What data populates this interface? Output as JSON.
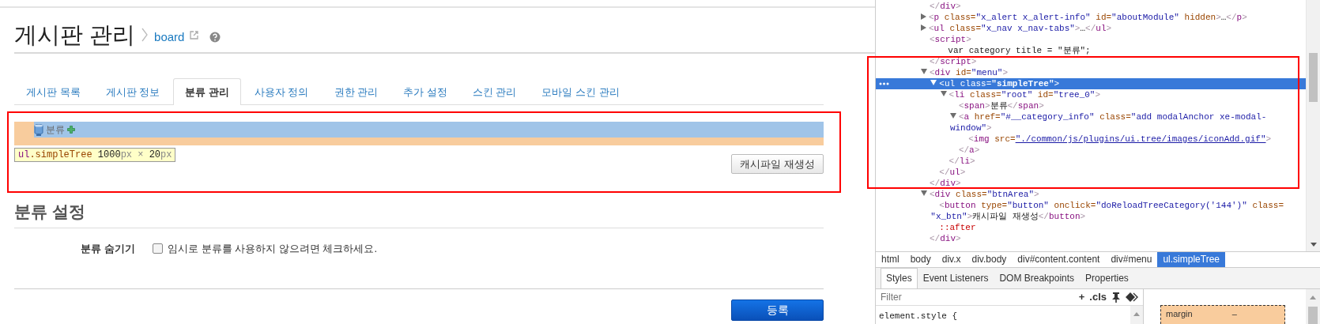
{
  "page": {
    "title": "게시판 관리",
    "module_link": "board",
    "tabs": [
      {
        "label": "게시판 목록",
        "selected": false
      },
      {
        "label": "게시판 정보",
        "selected": false
      },
      {
        "label": "분류 관리",
        "selected": true
      },
      {
        "label": "사용자 정의",
        "selected": false
      },
      {
        "label": "권한 관리",
        "selected": false
      },
      {
        "label": "추가 설정",
        "selected": false
      },
      {
        "label": "스킨 관리",
        "selected": false
      },
      {
        "label": "모바일 스킨 관리",
        "selected": false
      }
    ],
    "tree_root": {
      "label": "분류"
    },
    "inspector_tooltip": [
      {
        "text": "ul",
        "kind": "tag"
      },
      {
        "text": ".simpleTree",
        "kind": "class"
      },
      {
        "text": " 1000",
        "kind": "num"
      },
      {
        "text": "px",
        "kind": "unit"
      },
      {
        "text": " × ",
        "kind": "unit"
      },
      {
        "text": "20",
        "kind": "num"
      },
      {
        "text": "px",
        "kind": "unit"
      }
    ],
    "cache_button": "캐시파일 재생성",
    "settings": {
      "heading": "분류 설정",
      "rows": [
        {
          "label": "분류 숨기기",
          "checked": false,
          "description": "임시로 분류를 사용하지 않으려면 체크하세요."
        }
      ]
    },
    "submit_button": "등록"
  },
  "devtools": {
    "dom_tree": [
      {
        "kind": "line",
        "code": "</div>",
        "selected": false
      },
      {
        "kind": "element",
        "code": "<p class=\"x_alert x_alert-info\" id=\"aboutModule\" hidden>…</p>",
        "expanded": false,
        "selected": false
      },
      {
        "kind": "element",
        "code": "<ul class=\"x_nav x_nav-tabs\">…</ul>",
        "expanded": false,
        "selected": false
      },
      {
        "kind": "line",
        "code": "<script>",
        "selected": false,
        "children": [
          {
            "kind": "text",
            "code": "var category title = \"분류\";",
            "selected": false
          }
        ],
        "close": "</script>"
      },
      {
        "kind": "element",
        "code": "<div id=\"menu\">",
        "expanded": true,
        "selected": false,
        "children": [
          {
            "kind": "element",
            "code": "<ul class=\"simpleTree\">",
            "expanded": true,
            "selected": true,
            "children": [
              {
                "kind": "element",
                "code": "<li class=\"root\" id=\"tree_0\">",
                "expanded": true,
                "selected": false,
                "children": [
                  {
                    "kind": "line",
                    "code": "<span>분류</span>",
                    "selected": false
                  },
                  {
                    "kind": "element",
                    "code": "<a href=\"#__category_info\" class=\"add modalAnchor xe-modal-window\">",
                    "expanded": true,
                    "selected": false,
                    "children": [
                      {
                        "kind": "line",
                        "code": "<img src=\"./common/js/plugins/ui.tree/images/iconAdd.gif\">",
                        "selected": false,
                        "link": true
                      }
                    ],
                    "close": "</a>"
                  }
                ],
                "close": "</li>"
              }
            ],
            "close": "</ul>"
          }
        ],
        "close": "</div>"
      },
      {
        "kind": "element",
        "code": "<div class=\"btnArea\">",
        "expanded": true,
        "selected": false,
        "children": [
          {
            "kind": "line",
            "code": "<button type=\"button\" onclick=\"doReloadTreeCategory('144')\" class=\"x_btn\">캐시파일 재생성</button>",
            "selected": false
          },
          {
            "kind": "pseudo",
            "code": "::after",
            "selected": false
          }
        ],
        "close": "</div>"
      }
    ],
    "breadcrumbs": [
      {
        "label": "html",
        "selected": false
      },
      {
        "label": "body",
        "selected": false
      },
      {
        "label": "div.x",
        "selected": false
      },
      {
        "label": "div.body",
        "selected": false
      },
      {
        "label": "div#content.content",
        "selected": false
      },
      {
        "label": "div#menu",
        "selected": false
      },
      {
        "label": "ul.simpleTree",
        "selected": true
      }
    ],
    "tabs": [
      {
        "label": "Styles",
        "selected": true
      },
      {
        "label": "Event Listeners",
        "selected": false
      },
      {
        "label": "DOM Breakpoints",
        "selected": false
      },
      {
        "label": "Properties",
        "selected": false
      }
    ],
    "filter": {
      "placeholder": "Filter"
    },
    "toolbar": [
      "+",
      ".cls"
    ],
    "styles": [
      "element.style {"
    ],
    "box_model": {
      "label": "margin",
      "value": "–"
    }
  }
}
